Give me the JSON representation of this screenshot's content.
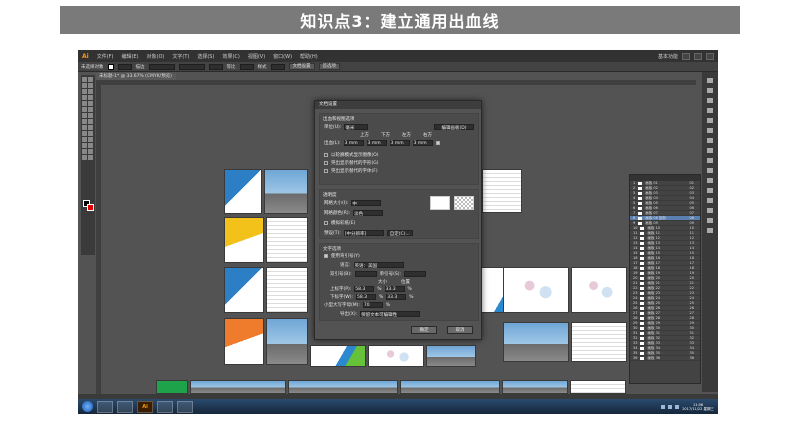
{
  "slide": {
    "title": "知识点3：建立通用出血线"
  },
  "app": {
    "logo": "Ai",
    "menu": [
      "文件(F)",
      "编辑(E)",
      "对象(O)",
      "文字(T)",
      "选择(S)",
      "效果(C)",
      "视图(V)",
      "窗口(W)",
      "帮助(H)"
    ],
    "workspace_label": "基本功能",
    "control_bar": {
      "label": "未选择对象",
      "stroke_label": "描边",
      "uniform_label": "等比",
      "style_label": "样式",
      "doc_setup_btn": "文档设置",
      "prefs_btn": "首选项"
    },
    "doc_tab": "未标题-1* @ 33.67% (CMYK/预览)"
  },
  "dialog": {
    "title": "文档设置",
    "bleed_section": {
      "label": "出血和视图选项",
      "unit_label": "单位(U):",
      "unit_value": "毫米",
      "edit_artboard_btn": "编辑画板(D)",
      "top_label": "上方",
      "bottom_label": "下方",
      "left_label": "左方",
      "right_label": "右方",
      "bleed_label": "出血(L):",
      "bleed_value": "3 mm",
      "options": [
        {
          "label": "以轮廓模式显示图像(O)",
          "checked": false
        },
        {
          "label": "突出显示替代的字形(G)",
          "checked": false
        },
        {
          "label": "突出显示替代的字体(F)",
          "checked": false
        }
      ]
    },
    "transparency_section": {
      "label": "透明度",
      "grid_size_label": "网格大小(I):",
      "grid_size_value": "中",
      "grid_color_label": "网格颜色(R):",
      "grid_color_value": "淡色",
      "simulate_paper_label": "模拟彩纸(E)",
      "preset_label": "预设(T):",
      "preset_value": "[中分辨率]",
      "custom_btn": "自定(C)..."
    },
    "type_section": {
      "label": "文字选项",
      "typographer_quotes_label": "使用弯引号(Y)",
      "language_label": "语言:",
      "language_value": "英语：美国",
      "double_quotes_label": "双引号(B):",
      "single_quotes_label": "单引号(S):",
      "size_col_label": "大小",
      "position_col_label": "位置",
      "superscript_label": "上标字(P):",
      "superscript_size": "58.3",
      "superscript_pos": "33.3",
      "subscript_label": "下标字(W):",
      "subscript_size": "58.3",
      "subscript_pos": "33.3",
      "smallcaps_label": "小型大写字母(M):",
      "smallcaps_value": "70",
      "percent": "%",
      "export_label": "导出(X):",
      "export_value": "保留文本可编辑性"
    },
    "ok_label": "确定",
    "cancel_label": "取消"
  },
  "layers": {
    "rows": [
      {
        "num": "1",
        "name": "画板 01",
        "n": "01"
      },
      {
        "num": "2",
        "name": "画板 02",
        "n": "02"
      },
      {
        "num": "3",
        "name": "画板 03",
        "n": "03"
      },
      {
        "num": "4",
        "name": "画板 04",
        "n": "04"
      },
      {
        "num": "5",
        "name": "画板 05",
        "n": "05"
      },
      {
        "num": "6",
        "name": "画板 06",
        "n": "06"
      },
      {
        "num": "7",
        "name": "画板 07",
        "n": "07"
      },
      {
        "num": "8",
        "name": "画板 08 复制",
        "n": "08"
      },
      {
        "num": "9",
        "name": "画板 09",
        "n": "09"
      },
      {
        "num": "10",
        "name": "画板 10",
        "n": "10"
      },
      {
        "num": "11",
        "name": "画板 11",
        "n": "11"
      },
      {
        "num": "12",
        "name": "画板 12",
        "n": "12"
      },
      {
        "num": "13",
        "name": "画板 13",
        "n": "13"
      },
      {
        "num": "14",
        "name": "画板 14",
        "n": "14"
      },
      {
        "num": "15",
        "name": "画板 15",
        "n": "15"
      },
      {
        "num": "16",
        "name": "画板 16",
        "n": "16"
      },
      {
        "num": "17",
        "name": "画板 17",
        "n": "17"
      },
      {
        "num": "18",
        "name": "画板 18",
        "n": "18"
      },
      {
        "num": "19",
        "name": "画板 19",
        "n": "19"
      },
      {
        "num": "20",
        "name": "画板 20",
        "n": "20"
      },
      {
        "num": "21",
        "name": "画板 21",
        "n": "21"
      },
      {
        "num": "22",
        "name": "画板 22",
        "n": "22"
      },
      {
        "num": "23",
        "name": "画板 23",
        "n": "23"
      },
      {
        "num": "24",
        "name": "画板 24",
        "n": "24"
      },
      {
        "num": "25",
        "name": "画板 25",
        "n": "25"
      },
      {
        "num": "26",
        "name": "画板 26",
        "n": "26"
      },
      {
        "num": "27",
        "name": "画板 27",
        "n": "27"
      },
      {
        "num": "28",
        "name": "画板 28",
        "n": "28"
      },
      {
        "num": "29",
        "name": "画板 29",
        "n": "29"
      },
      {
        "num": "30",
        "name": "画板 30",
        "n": "30"
      },
      {
        "num": "31",
        "name": "画板 31",
        "n": "31"
      },
      {
        "num": "32",
        "name": "画板 32",
        "n": "32"
      },
      {
        "num": "33",
        "name": "画板 33",
        "n": "33"
      },
      {
        "num": "34",
        "name": "画板 34",
        "n": "34"
      },
      {
        "num": "35",
        "name": "画板 35",
        "n": "35"
      },
      {
        "num": "36",
        "name": "画板 36",
        "n": "36"
      }
    ]
  },
  "taskbar": {
    "apps": [
      "",
      "",
      "Ai",
      "",
      ""
    ],
    "clock_time": "11:06",
    "clock_date": "2017/11/22 星期三"
  },
  "colors": {
    "accent_blue": "#2c7fc4",
    "accent_green": "#67c23a",
    "accent_yellow": "#f3c21a",
    "accent_orange": "#ef7b2c",
    "ai_orange": "#ff9a00"
  }
}
